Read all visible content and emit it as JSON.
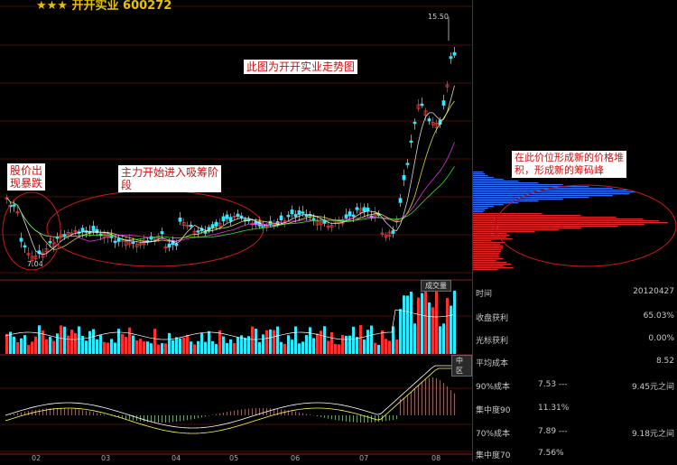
{
  "header": {
    "stock_title": "开开实业 600272",
    "stars": "★★★"
  },
  "annotations": {
    "trend_note": "此图为开开实业走势图",
    "crash_note": "股价出\n现暴跌",
    "accumulation_note": "主力开始进入吸筹阶\n段",
    "chip_peak_note": "在此价位形成新的价格堆\n积，形成新的筹码峰"
  },
  "price_chart": {
    "high_label": "15.50",
    "low_label": "7.04",
    "up_color": "#ff3030",
    "down_color": "#30e8ff"
  },
  "volume_panel": {
    "tag": "成交量"
  },
  "macd_panel": {
    "tag": "中区"
  },
  "x_axis": {
    "labels": [
      "02",
      "03",
      "04",
      "05",
      "06",
      "07",
      "08"
    ]
  },
  "stats": {
    "time_label": "时间",
    "time_value": "20120427",
    "profit_label": "收盘获利",
    "profit_value": "65.03%",
    "cursor_profit_label": "光标获利",
    "cursor_profit_value": "0.00%",
    "avg_cost_label": "平均成本",
    "avg_cost_value": "8.52",
    "cost90_label": "90%成本",
    "cost90_low": "7.53",
    "cost90_high": "9.45元之间",
    "conc90_label": "集中度90",
    "conc90_value": "11.31%",
    "cost70_label": "70%成本",
    "cost70_low": "7.89",
    "cost70_high": "9.18元之间",
    "conc70_label": "集中度70",
    "conc70_value": "7.56%"
  }
}
